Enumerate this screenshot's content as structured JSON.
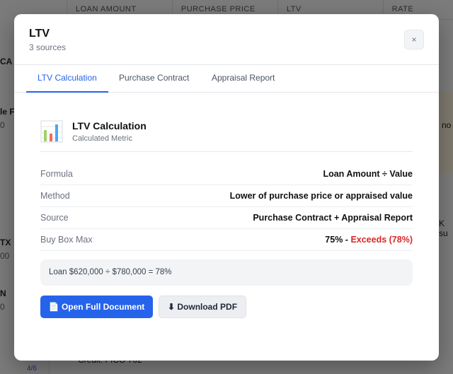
{
  "background": {
    "columns": [
      "LOAN AMOUNT",
      "PURCHASE PRICE",
      "LTV",
      "RATE"
    ],
    "fragments": [
      "CA",
      "le F",
      "0",
      "TX",
      "00",
      "N",
      "0",
      "4/6",
      "no",
      "K su",
      "Credit: FICO 702"
    ]
  },
  "modal": {
    "title": "LTV",
    "subtitle": "3 sources",
    "close_label": "×",
    "tabs": [
      {
        "label": "LTV Calculation",
        "active": true
      },
      {
        "label": "Purchase Contract"
      },
      {
        "label": "Appraisal Report"
      }
    ],
    "card": {
      "icon": "bar-chart-icon",
      "title": "LTV Calculation",
      "subtitle": "Calculated Metric"
    },
    "rows": [
      {
        "label": "Formula",
        "value": "Loan Amount ÷ Value"
      },
      {
        "label": "Method",
        "value": "Lower of purchase price or appraised value"
      },
      {
        "label": "Source",
        "value": "Purchase Contract + Appraisal Report"
      },
      {
        "label": "Buy Box Max",
        "value": "75% - ",
        "flag": "Exceeds (78%)"
      }
    ],
    "calculation": "Loan $620,000 ÷ $780,000 = 78%",
    "buttons": {
      "open": "📄 Open Full Document",
      "download": "⬇ Download PDF"
    },
    "colors": {
      "accent": "#2563eb",
      "danger": "#dc2626"
    }
  }
}
